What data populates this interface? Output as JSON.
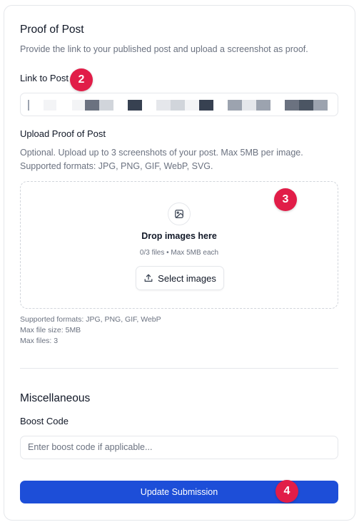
{
  "proof_section": {
    "title": "Proof of Post",
    "description": "Provide the link to your published post and upload a screenshot as proof."
  },
  "link_field": {
    "label": "Link to Post",
    "value_redacted": true
  },
  "upload": {
    "label": "Upload Proof of Post",
    "description_line1": "Optional. Upload up to 3 screenshots of your post. Max 5MB per image.",
    "description_line2": "Supported formats: JPG, PNG, GIF, WebP, SVG.",
    "drop_title": "Drop images here",
    "drop_subtitle": "0/3 files • Max 5MB each",
    "select_button": "Select images",
    "note_formats": "Supported formats: JPG, PNG, GIF, WebP",
    "note_size": "Max file size: 5MB",
    "note_files": "Max files: 3"
  },
  "misc_section": {
    "title": "Miscellaneous",
    "boost_label": "Boost Code",
    "boost_placeholder": "Enter boost code if applicable..."
  },
  "submit": {
    "label": "Update Submission"
  },
  "badges": [
    "2",
    "3",
    "4"
  ],
  "colors": {
    "primary": "#1d4ed8",
    "badge": "#e11d48"
  }
}
